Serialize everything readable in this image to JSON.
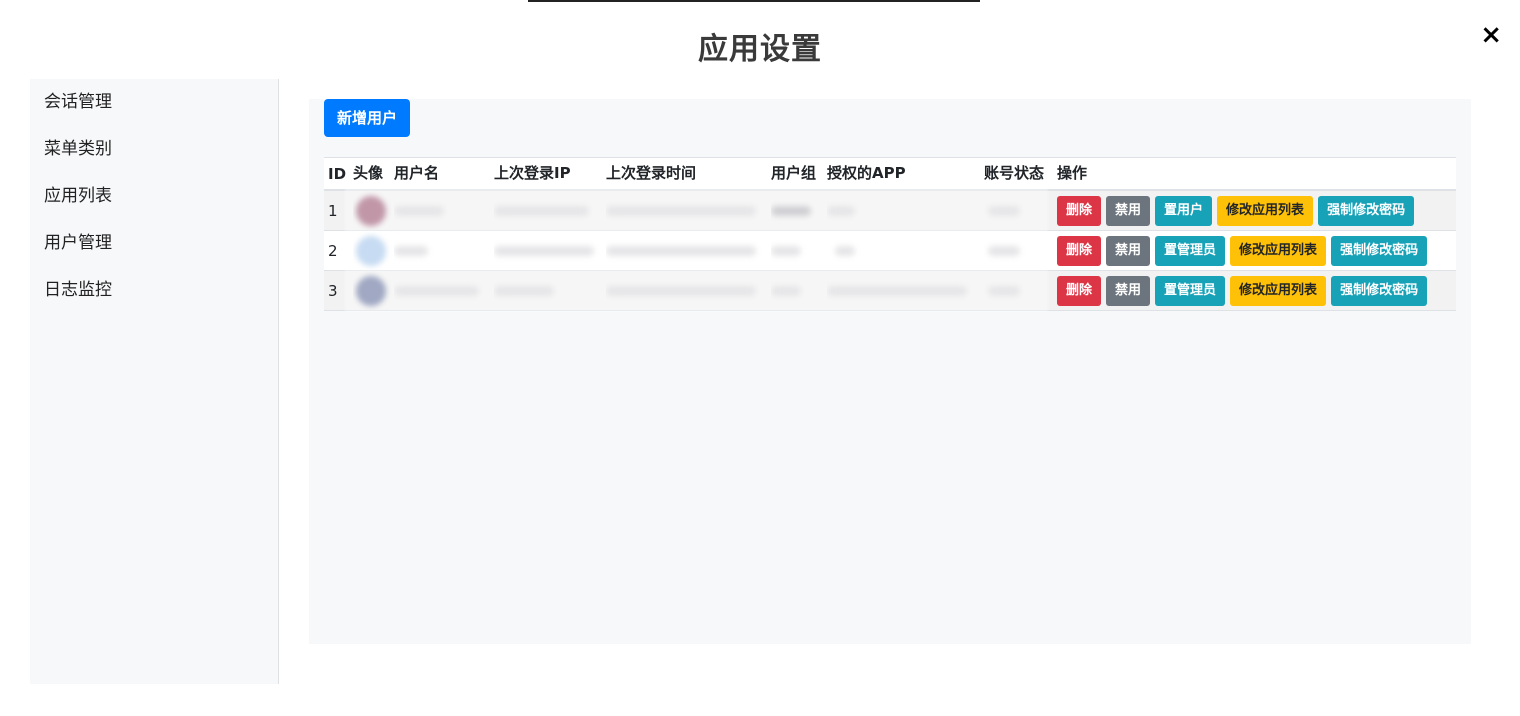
{
  "modal": {
    "title": "应用设置",
    "close_label": "×"
  },
  "sidebar": {
    "items": [
      {
        "label": "会话管理"
      },
      {
        "label": "菜单类别"
      },
      {
        "label": "应用列表"
      },
      {
        "label": "用户管理"
      },
      {
        "label": "日志监控"
      }
    ]
  },
  "toolbar": {
    "add_user_label": "新增用户"
  },
  "table": {
    "headers": {
      "id": "ID",
      "avatar": "头像",
      "username": "用户名",
      "last_ip": "上次登录IP",
      "last_time": "上次登录时间",
      "group": "用户组",
      "apps": "授权的APP",
      "status": "账号状态",
      "ops": "操作"
    },
    "rows": [
      {
        "id": "1",
        "avatar_color": "#a0607a",
        "actions": {
          "delete": "删除",
          "disable": "禁用",
          "role": "置用户",
          "edit_apps": "修改应用列表",
          "reset_pwd": "强制修改密码"
        }
      },
      {
        "id": "2",
        "avatar_color": "#a9c9ec",
        "actions": {
          "delete": "删除",
          "disable": "禁用",
          "role": "置管理员",
          "edit_apps": "修改应用列表",
          "reset_pwd": "强制修改密码"
        }
      },
      {
        "id": "3",
        "avatar_color": "#6d7aa3",
        "actions": {
          "delete": "删除",
          "disable": "禁用",
          "role": "置管理员",
          "edit_apps": "修改应用列表",
          "reset_pwd": "强制修改密码"
        }
      }
    ]
  },
  "colors": {
    "primary": "#007bff",
    "danger": "#dc3545",
    "secondary": "#6c757d",
    "info": "#17a2b8",
    "warning": "#ffc107"
  }
}
